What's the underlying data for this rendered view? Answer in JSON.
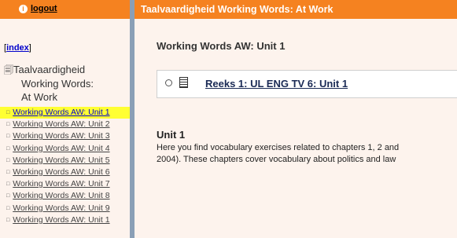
{
  "sidebar": {
    "logout_badge": "i",
    "logout_label": "logout",
    "index_label": "index",
    "tree_root_lines": [
      "Taalvaardigheid",
      "Working Words:",
      "At Work"
    ],
    "units": [
      {
        "label": "Working Words AW: Unit 1",
        "active": true
      },
      {
        "label": "Working Words AW: Unit 2"
      },
      {
        "label": "Working Words AW: Unit 3"
      },
      {
        "label": "Working Words AW: Unit 4"
      },
      {
        "label": "Working Words AW: Unit 5"
      },
      {
        "label": "Working Words AW: Unit 6"
      },
      {
        "label": "Working Words AW: Unit 7"
      },
      {
        "label": "Working Words AW: Unit 8"
      },
      {
        "label": "Working Words AW: Unit 9"
      },
      {
        "label": "Working Words AW: Unit 1"
      }
    ]
  },
  "main": {
    "header_title": "Taalvaardigheid Working Words: At Work",
    "page_title": "Working Words AW: Unit 1",
    "reeks_link": "Reeks 1: UL ENG TV 6: Unit 1",
    "unit_heading": "Unit 1",
    "unit_desc_line1": "Here you find vocabulary exercises related to chapters 1, 2 and",
    "unit_desc_line2": "2004). These chapters cover vocabulary about politics and law"
  },
  "colors": {
    "header_orange": "#f58220",
    "background": "#fdf3ed",
    "active_highlight": "#ffff33",
    "divider": "#8a9fb6"
  }
}
